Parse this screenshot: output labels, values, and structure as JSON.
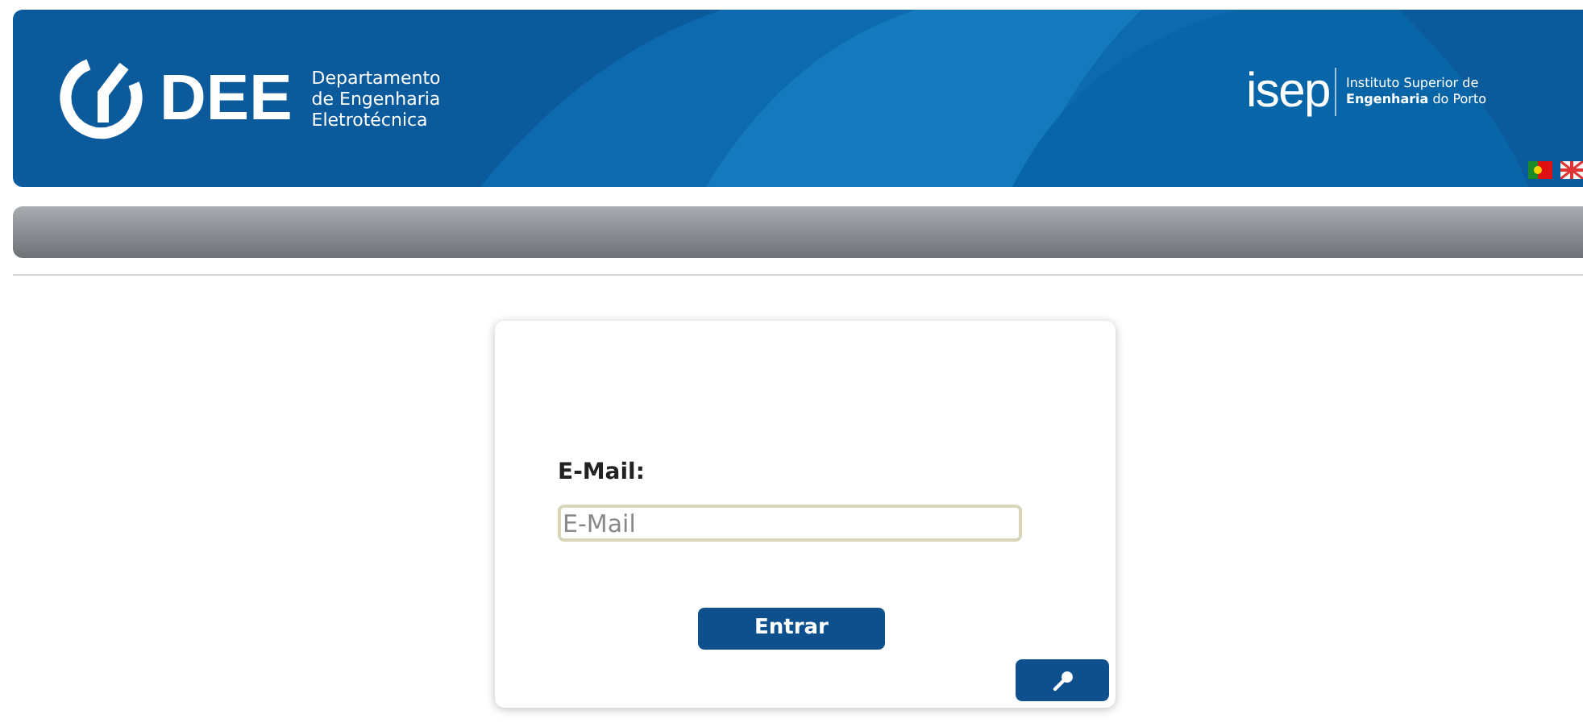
{
  "header": {
    "logo_text": "DEE",
    "department_lines": [
      "Departamento",
      "de Engenharia",
      "Eletrotécnica"
    ],
    "isep_logo_text": "isep",
    "institute_lines": [
      "Instituto Superior de",
      "**Engenharia** do Porto"
    ]
  },
  "login": {
    "label": "E-Mail:",
    "field": {
      "placeholder": "E-Mail"
    },
    "submit": "Entrar"
  }
}
